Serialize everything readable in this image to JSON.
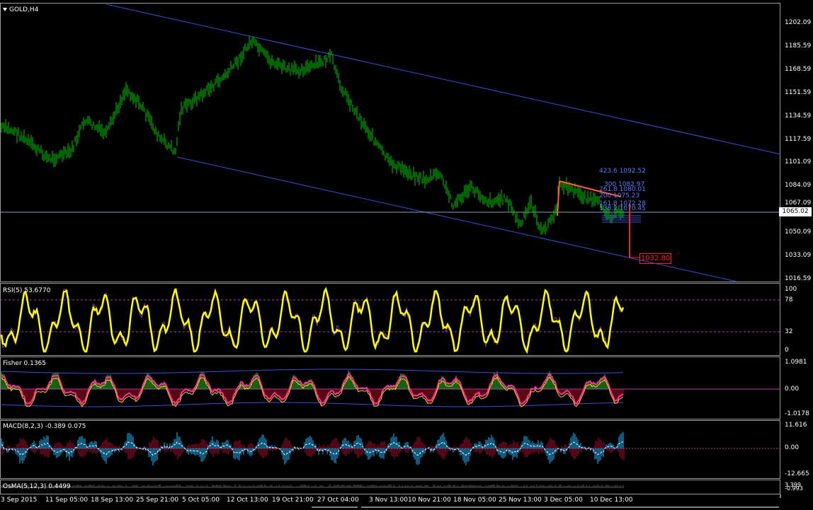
{
  "window": {
    "title": "GOLD,H4"
  },
  "price_axis": [
    "1202.09",
    "1185.59",
    "1168.59",
    "1151.59",
    "1134.59",
    "1117.59",
    "1101.09",
    "1084.09",
    "1067.09",
    "1050.09",
    "1033.09",
    "1016.59"
  ],
  "current_price": "1065.02",
  "target_price": "1032.80",
  "fib_levels": [
    "423.6 1092.52",
    "300 1082.97",
    "261.8 1080.01",
    "200 1075.23",
    "161.8 1072.28",
    "138.2 1070.45"
  ],
  "rsi": {
    "title": "RSI(5) 53.6770",
    "axis": [
      "100",
      "78",
      "32",
      "0"
    ]
  },
  "fisher": {
    "title": "Fisher 0.1365",
    "axis": [
      "1.0981",
      "0.00",
      "-1.0178"
    ]
  },
  "macd": {
    "title": "MACD(8,2,3) -0.389 0.075",
    "axis": [
      "11.616",
      "0.00",
      "-12.665"
    ]
  },
  "osma": {
    "title": "OsMA(5,12,3) 0.4499",
    "axis": [
      "3.399",
      "-0.993"
    ]
  },
  "dates": [
    "3 Sep 2015",
    "11 Sep 05:00",
    "18 Sep 13:00",
    "25 Sep 21:00",
    "5 Oct 05:00",
    "12 Oct 13:00",
    "19 Oct 21:00",
    "27 Oct 04:00",
    "3 Nov 13:00",
    "10 Nov 21:00",
    "18 Nov 05:00",
    "25 Nov 13:00",
    "3 Dec 05:00",
    "10 Dec 13:00"
  ],
  "colors": {
    "bull": "#00d000",
    "channel": "#3a4fd0",
    "rsi": "#ffff00",
    "macd": "#1fb8ff",
    "target": "#ff2020"
  }
}
